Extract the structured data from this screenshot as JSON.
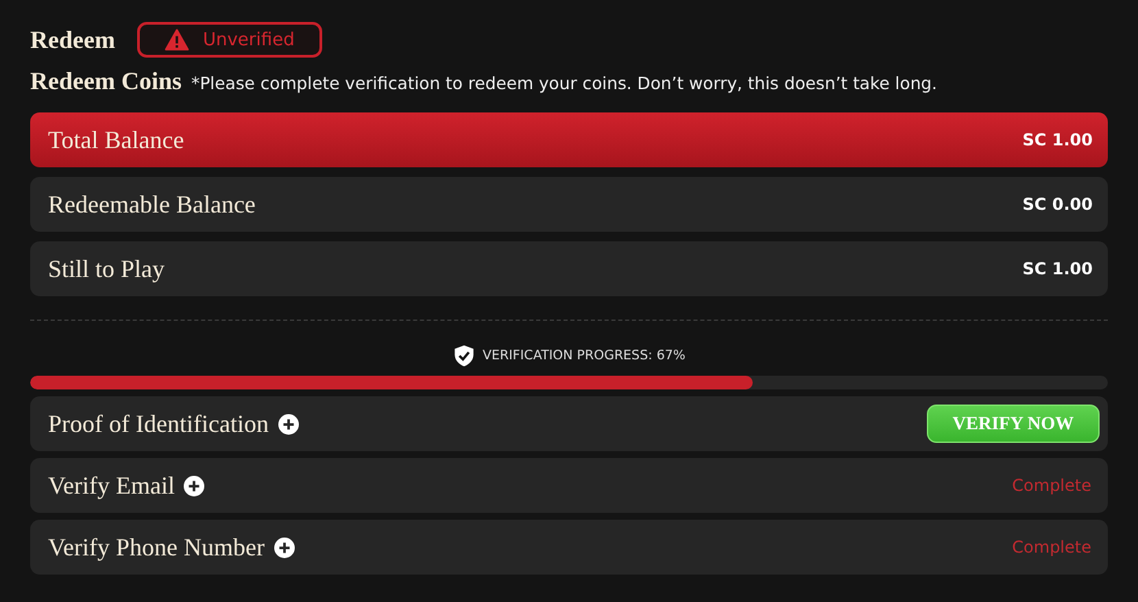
{
  "header": {
    "title": "Redeem",
    "badge": "Unverified"
  },
  "coins": {
    "title": "Redeem Coins",
    "note": "*Please complete verification to redeem your coins. Don’t worry, this doesn’t take long."
  },
  "balances": [
    {
      "label": "Total Balance",
      "amount": "SC 1.00",
      "kind": "highlight"
    },
    {
      "label": "Redeemable Balance",
      "amount": "SC 0.00",
      "kind": "plain"
    },
    {
      "label": "Still to Play",
      "amount": "SC 1.00",
      "kind": "plain"
    }
  ],
  "progress": {
    "label": "VERIFICATION PROGRESS: 67%",
    "level": 0.67
  },
  "tasks": [
    {
      "label": "Proof of Identification",
      "kind": "button",
      "action": "VERIFY NOW"
    },
    {
      "label": "Verify Email",
      "kind": "status",
      "action": "Complete"
    },
    {
      "label": "Verify Phone Number",
      "kind": "status",
      "action": "Complete"
    }
  ]
}
